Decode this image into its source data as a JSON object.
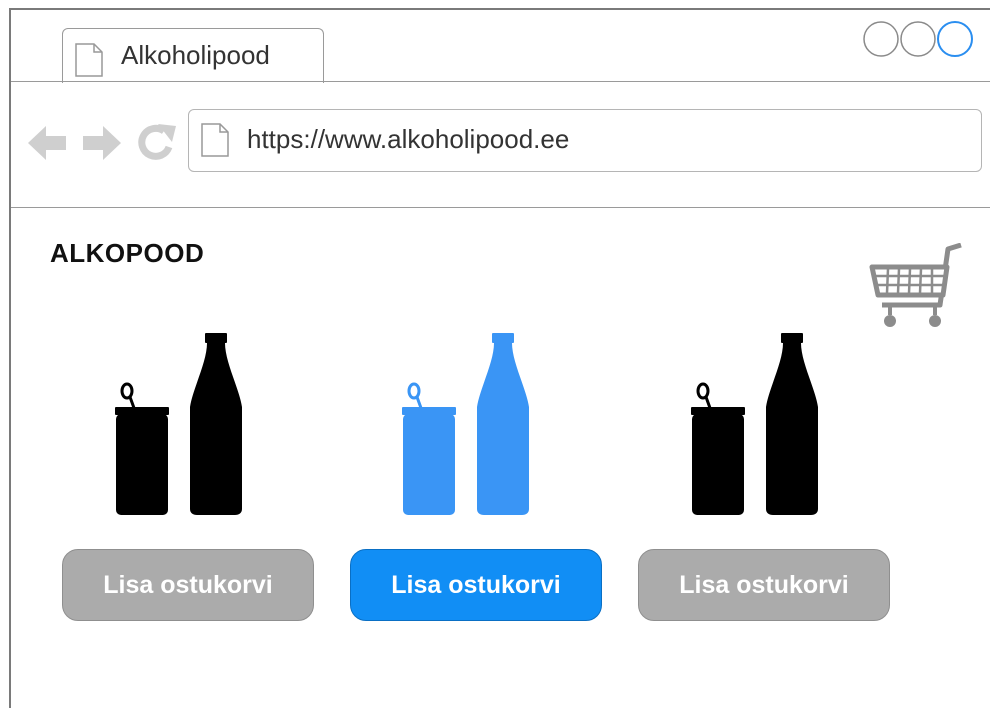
{
  "browser": {
    "tab_title": "Alkoholipood",
    "url": "https://www.alkoholipood.ee"
  },
  "page": {
    "logo": "ALKOPOOD",
    "products": [
      {
        "button_label": "Lisa ostukorvi",
        "state": "default",
        "icon": "can-and-bottle-icon",
        "color": "#000000"
      },
      {
        "button_label": "Lisa ostukorvi",
        "state": "selected",
        "icon": "can-and-bottle-icon",
        "color": "#3a95f5"
      },
      {
        "button_label": "Lisa ostukorvi",
        "state": "default",
        "icon": "can-and-bottle-icon",
        "color": "#000000"
      }
    ]
  },
  "colors": {
    "accent": "#118ef5",
    "button_grey": "#ababab",
    "icon_grey": "#cccccc"
  }
}
